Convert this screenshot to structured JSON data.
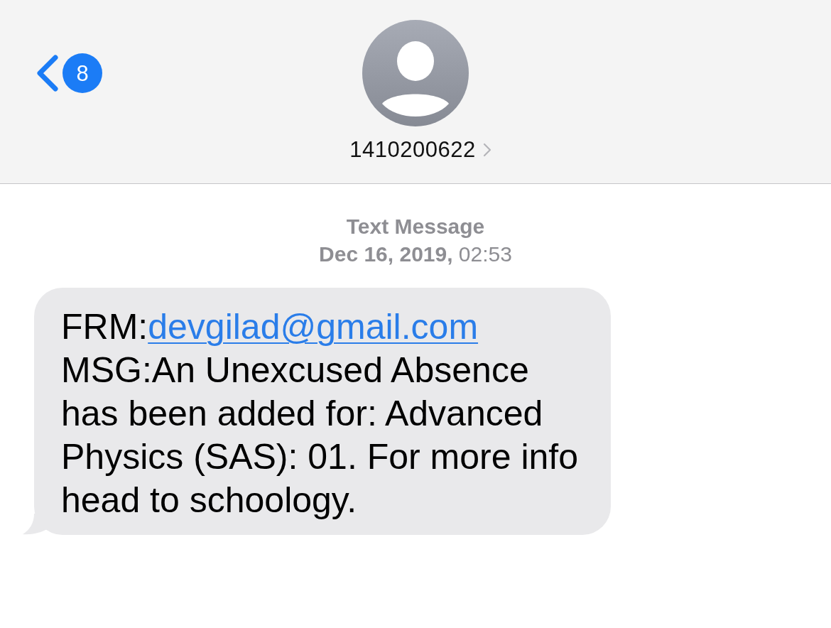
{
  "header": {
    "back_button": {
      "badge": "8"
    },
    "contact": {
      "number": "1410200622"
    }
  },
  "conversation": {
    "service_label": "Text Message",
    "timestamp": "**Dec 16, 2019,** 02:53",
    "messages": [
      {
        "kind": "incoming",
        "sender_prefix": "FRM:",
        "sender_link": "devgilad@gmail.com",
        "body": "MSG:An Unexcused Absence has been added for: Advanced Physics (SAS): 01. For more info head to schoology."
      }
    ]
  }
}
